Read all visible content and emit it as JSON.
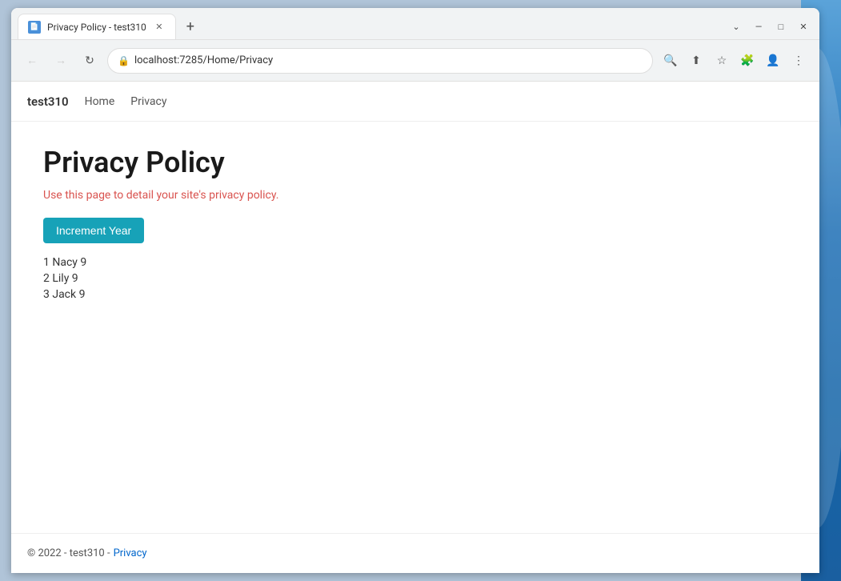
{
  "window": {
    "title": "Privacy Policy - test310",
    "url": "localhost:7285/Home/Privacy"
  },
  "titlebar": {
    "tab_label": "Privacy Policy - test310",
    "new_tab_label": "+",
    "minimize": "—",
    "maximize": "□",
    "close": "✕",
    "chevron": "⌄"
  },
  "addressbar": {
    "back": "←",
    "forward": "→",
    "refresh": "↻",
    "lock": "🔒",
    "url": "localhost:7285/Home/Privacy",
    "search_icon": "🔍",
    "share_icon": "⬆",
    "star_icon": "☆",
    "extensions_icon": "🧩",
    "profile_icon": "👤",
    "menu_icon": "⋮"
  },
  "navbar": {
    "brand": "test310",
    "links": [
      {
        "label": "Home",
        "href": "/"
      },
      {
        "label": "Privacy",
        "href": "/Home/Privacy"
      }
    ]
  },
  "page": {
    "title": "Privacy Policy",
    "subtitle": "Use this page to detail your site's privacy policy.",
    "button_label": "Increment Year",
    "items": [
      {
        "id": 1,
        "name": "Nacy",
        "value": 9
      },
      {
        "id": 2,
        "name": "Lily",
        "value": 9
      },
      {
        "id": 3,
        "name": "Jack",
        "value": 9
      }
    ]
  },
  "footer": {
    "copyright": "© 2022 - test310 - ",
    "link_label": "Privacy"
  }
}
